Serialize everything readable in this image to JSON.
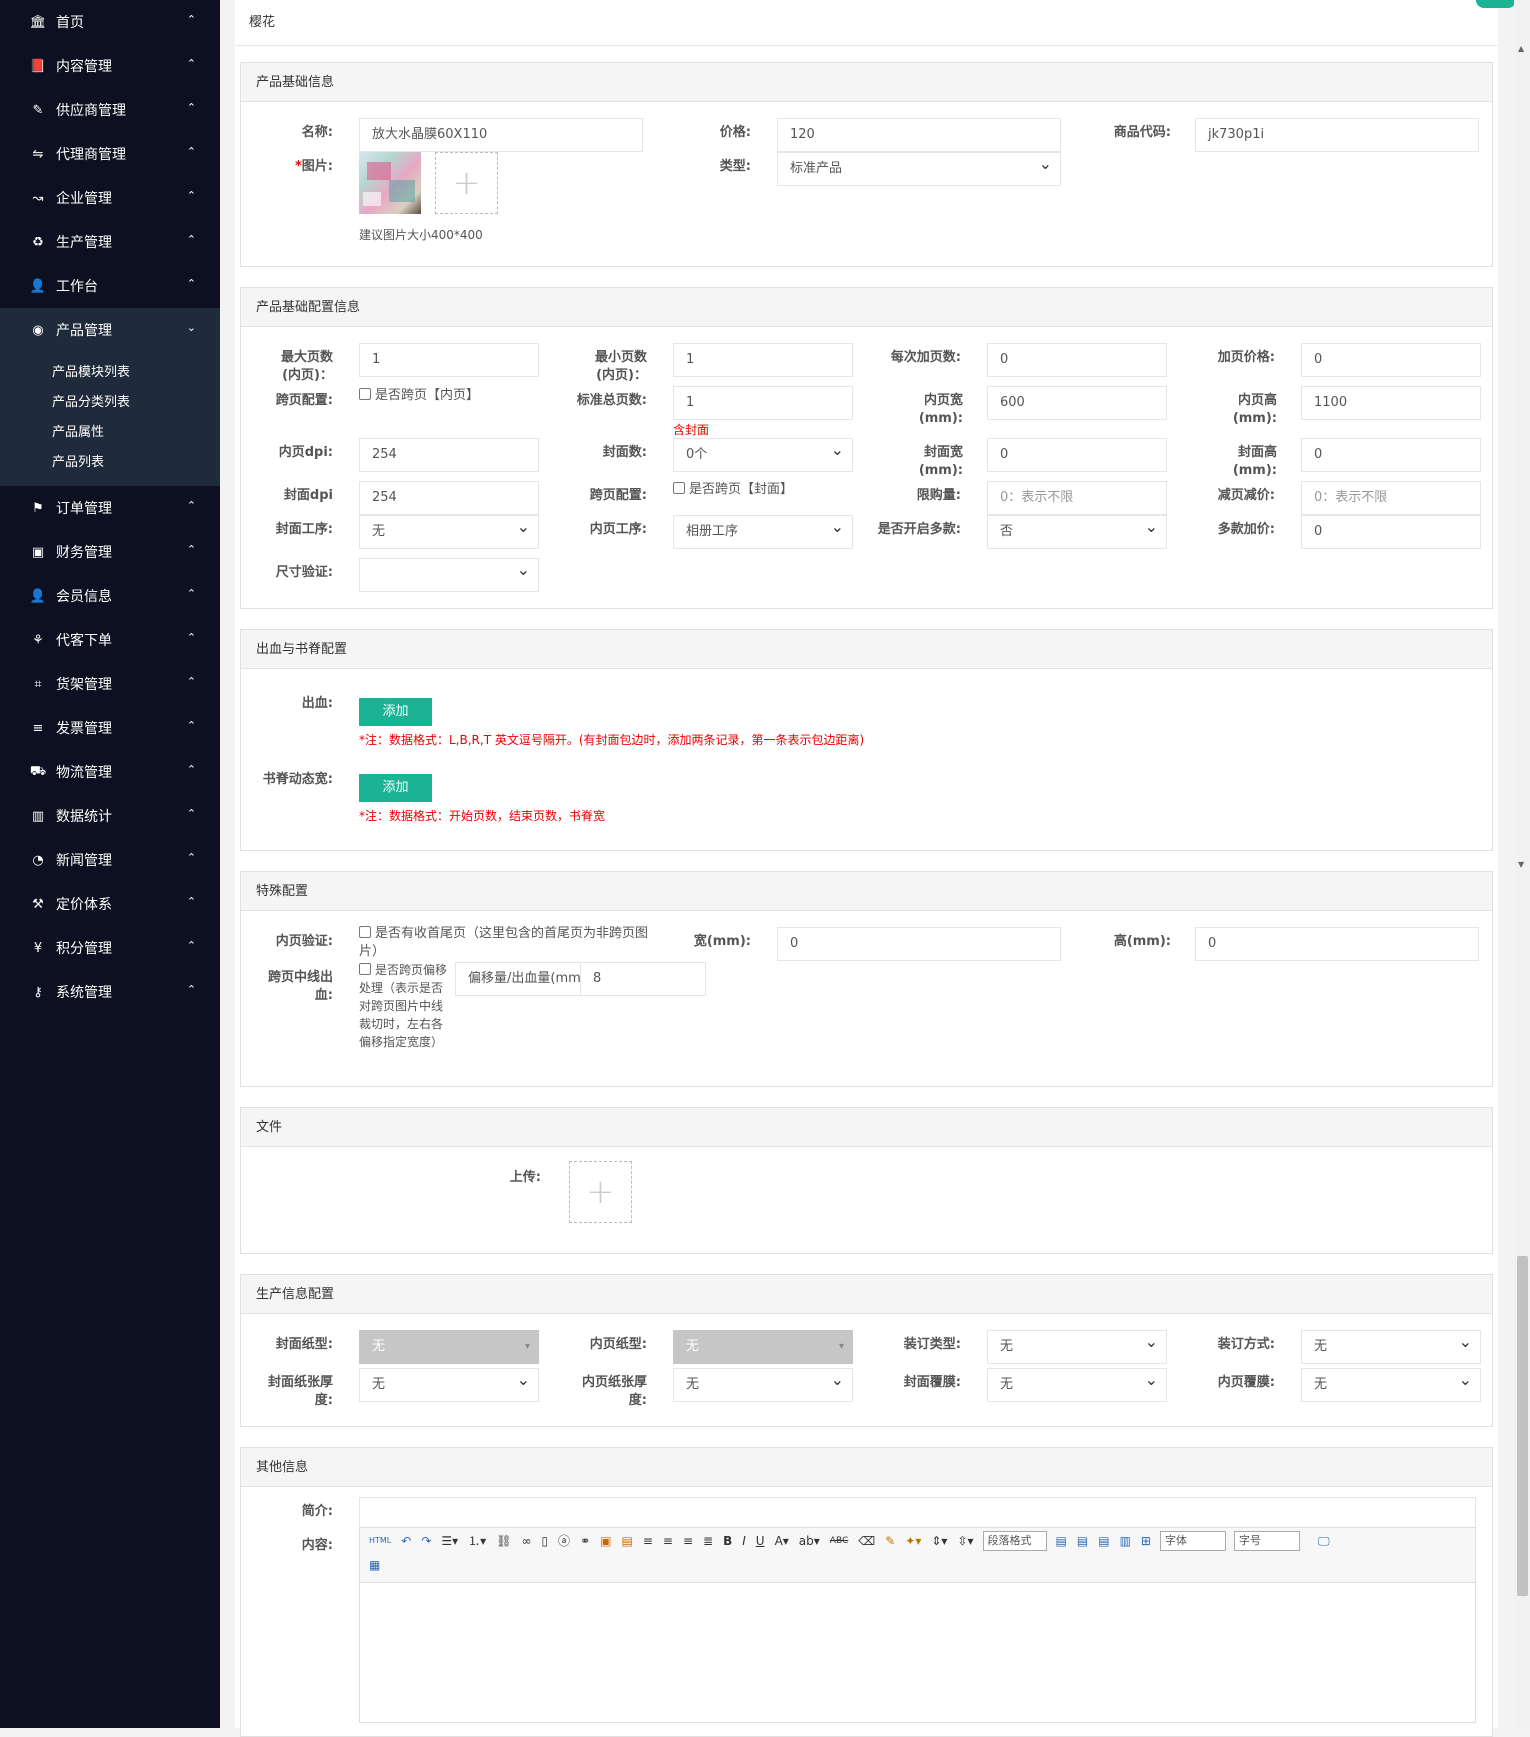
{
  "sidebar": {
    "items": [
      {
        "label": "首页",
        "icon": "🏛"
      },
      {
        "label": "内容管理",
        "icon": "📕"
      },
      {
        "label": "供应商管理",
        "icon": "✎"
      },
      {
        "label": "代理商管理",
        "icon": "⇋"
      },
      {
        "label": "企业管理",
        "icon": "↝"
      },
      {
        "label": "生产管理",
        "icon": "♻"
      },
      {
        "label": "工作台",
        "icon": "👤"
      },
      {
        "label": "产品管理",
        "icon": "◉"
      },
      {
        "label": "订单管理",
        "icon": "⚑"
      },
      {
        "label": "财务管理",
        "icon": "▣"
      },
      {
        "label": "会员信息",
        "icon": "👤"
      },
      {
        "label": "代客下单",
        "icon": "⚘"
      },
      {
        "label": "货架管理",
        "icon": "⌗"
      },
      {
        "label": "发票管理",
        "icon": "≡"
      },
      {
        "label": "物流管理",
        "icon": "⛟"
      },
      {
        "label": "数据统计",
        "icon": "▥"
      },
      {
        "label": "新闻管理",
        "icon": "◔"
      },
      {
        "label": "定价体系",
        "icon": "⚒"
      },
      {
        "label": "积分管理",
        "icon": "¥"
      },
      {
        "label": "系统管理",
        "icon": "⚷"
      }
    ],
    "subitems": [
      "产品模块列表",
      "产品分类列表",
      "产品属性",
      "产品列表"
    ]
  },
  "page": {
    "title": "樱花"
  },
  "basic": {
    "header": "产品基础信息",
    "name_label": "名称:",
    "name_value": "放大水晶膜60X110",
    "price_label": "价格:",
    "price_value": "120",
    "code_label": "商品代码:",
    "code_value": "jk730p1i",
    "image_label_star": "*",
    "image_label": "图片:",
    "type_label": "类型:",
    "type_value": "标准产品",
    "image_hint": "建议图片大小400*400"
  },
  "config": {
    "header": "产品基础配置信息",
    "max_pages_label": "最大页数(内页)：",
    "max_pages": "1",
    "min_pages_label": "最小页数(内页)：",
    "min_pages": "1",
    "add_pages_label": "每次加页数:",
    "add_pages": "0",
    "add_price_label": "加页价格:",
    "add_price": "0",
    "spread_label": "跨页配置:",
    "spread_check": "是否跨页【内页】",
    "std_pages_label": "标准总页数:",
    "std_pages": "1",
    "std_note": "含封面",
    "inner_w_label": "内页宽(mm):",
    "inner_w": "600",
    "inner_h_label": "内页高(mm):",
    "inner_h": "1100",
    "inner_dpi_label": "内页dpi:",
    "inner_dpi": "254",
    "cover_count_label": "封面数:",
    "cover_count": "0个",
    "cover_w_label": "封面宽(mm):",
    "cover_w": "0",
    "cover_h_label": "封面高(mm):",
    "cover_h": "0",
    "cover_dpi_label": "封面dpi",
    "cover_dpi": "254",
    "spread2_label": "跨页配置:",
    "spread2_check": "是否跨页【封面】",
    "limit_label": "限购量:",
    "limit_ph": "0：表示不限",
    "reduce_label": "减页减价:",
    "reduce_ph": "0：表示不限",
    "cover_proc_label": "封面工序:",
    "cover_proc": "无",
    "inner_proc_label": "内页工序:",
    "inner_proc": "相册工序",
    "multi_label": "是否开启多款:",
    "multi": "否",
    "multi_price_label": "多款加价:",
    "multi_price": "0",
    "size_label": "尺寸验证:",
    "size": ""
  },
  "bleed": {
    "header": "出血与书脊配置",
    "bleed_label": "出血:",
    "add_label": "添加",
    "bleed_note": "*注：数据格式：L,B,R,T 英文逗号隔开。(有封面包边时，添加两条记录，第一条表示包边距离)",
    "spine_label": "书脊动态宽:",
    "add_label2": "添加",
    "spine_note": "*注：数据格式：开始页数，结束页数，书脊宽"
  },
  "special": {
    "header": "特殊配置",
    "inner_verify_label": "内页验证:",
    "inner_verify_check": "是否有收首尾页（这里包含的首尾页为非跨页图片）",
    "w_label": "宽(mm):",
    "w": "0",
    "h_label": "高(mm):",
    "h": "0",
    "spread_line_label": "跨页中线出血:",
    "offset_check": "是否跨页偏移处理（表示是否对跨页图片中线裁切时，左右各偏移指定宽度）",
    "offset_label": "偏移量/出血量(mm):",
    "offset": "8"
  },
  "file": {
    "header": "文件",
    "upload_label": "上传:"
  },
  "production": {
    "header": "生产信息配置",
    "cover_paper_label": "封面纸型:",
    "cover_paper": "无",
    "inner_paper_label": "内页纸型:",
    "inner_paper": "无",
    "bind_type_label": "装订类型:",
    "bind_type": "无",
    "bind_way_label": "装订方式:",
    "bind_way": "无",
    "cover_thick_label": "封面纸张厚度:",
    "cover_thick": "无",
    "inner_thick_label": "内页纸张厚度:",
    "inner_thick": "无",
    "cover_film_label": "封面覆膜:",
    "cover_film": "无",
    "inner_film_label": "内页覆膜:",
    "inner_film": "无"
  },
  "other": {
    "header": "其他信息",
    "intro_label": "简介:",
    "intro": "",
    "content_label": "内容:",
    "toolbar_para": "段落格式",
    "toolbar_font": "字体",
    "toolbar_size": "字号"
  }
}
